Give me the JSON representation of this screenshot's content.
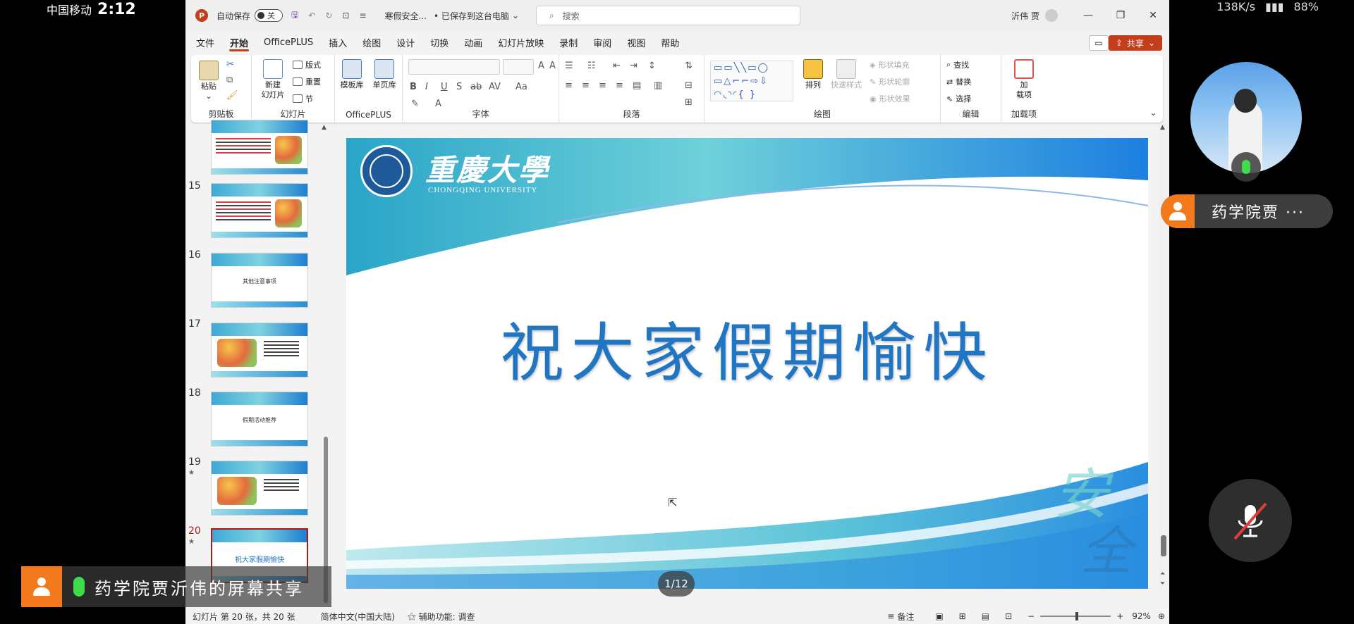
{
  "phone_status": {
    "carrier": "中国移动",
    "time": "2:12",
    "network_speed": "138K/s",
    "battery": "88%"
  },
  "titlebar": {
    "autosave_label": "自动保存",
    "autosave_state": "关",
    "doc_name": "寒假安全...",
    "save_status": "• 已保存到这台电脑",
    "search_placeholder": "搜索",
    "user": "沂伟 贾"
  },
  "menu": {
    "items": [
      "文件",
      "开始",
      "OfficePLUS",
      "插入",
      "绘图",
      "设计",
      "切换",
      "动画",
      "幻灯片放映",
      "录制",
      "审阅",
      "视图",
      "帮助"
    ],
    "active": "开始",
    "share_label": "共享"
  },
  "ribbon": {
    "clipboard": {
      "label": "剪贴板",
      "paste": "粘贴"
    },
    "slides": {
      "label": "幻灯片",
      "new_slide_1": "新建",
      "new_slide_2": "幻灯片",
      "layout": "版式",
      "reset": "重置",
      "section": "节"
    },
    "officeplus": {
      "label": "OfficePLUS",
      "template": "模板库",
      "single": "单页库"
    },
    "font": {
      "label": "字体"
    },
    "paragraph": {
      "label": "段落"
    },
    "drawing": {
      "label": "绘图",
      "arrange": "排列",
      "quick_styles": "快速样式",
      "fill": "形状填充",
      "outline": "形状轮廓",
      "effects": "形状效果"
    },
    "editing": {
      "label": "编辑",
      "find": "查找",
      "replace": "替换",
      "select": "选择"
    },
    "addins": {
      "label": "加载项",
      "add_1": "加",
      "add_2": "载项"
    }
  },
  "thumbnails": [
    {
      "num": "15",
      "text": ""
    },
    {
      "num": "16",
      "text": "其他注意事项"
    },
    {
      "num": "17",
      "text": ""
    },
    {
      "num": "18",
      "text": "假期活动推荐"
    },
    {
      "num": "19",
      "text": ""
    },
    {
      "num": "20",
      "text": "祝大家假期愉快"
    }
  ],
  "slide": {
    "title": "祝大家假期愉快",
    "university_cn": "重慶大學",
    "university_en": "CHONGQING UNIVERSITY",
    "watermark_1": "安",
    "watermark_2": "全",
    "page_indicator": "1/12"
  },
  "statusbar": {
    "slide_info": "幻灯片 第 20 张，共 20 张",
    "language": "简体中文(中国大陆)",
    "accessibility": "辅助功能: 调查",
    "notes": "备注",
    "zoom": "92%"
  },
  "meeting": {
    "participant_name": "药学院贾 ···",
    "share_banner": "药学院贾沂伟的屏幕共享"
  },
  "colors": {
    "ppt_accent": "#c43e1c",
    "slide_title": "#2076c2",
    "meeting_orange": "#f27a1d",
    "mic_green": "#3fdc4b"
  }
}
